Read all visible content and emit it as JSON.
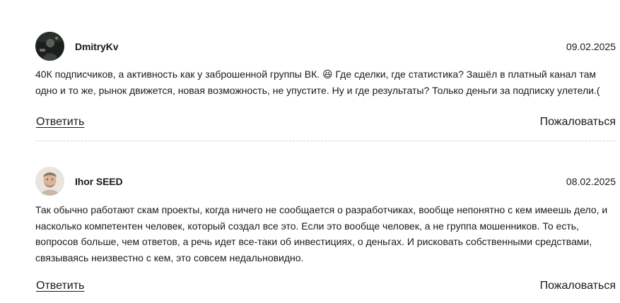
{
  "comments": [
    {
      "author": "DmitryKv",
      "date": "09.02.2025",
      "text": "40К подписчиков, а активность как у заброшенной группы ВК. 😆 Где сделки, где статистика? Зашёл в платный канал там\nодно и то же, рынок движется, новая возможность, не упустите. Ну и где результаты? Только деньги за подписку улетели.(",
      "reply_label": "Ответить",
      "report_label": "Пожаловаться"
    },
    {
      "author": "Ihor SEED",
      "date": "08.02.2025",
      "text": "Так обычно работают скам проекты, когда ничего не сообщается о разработчиках, вообще непонятно с кем имеешь дело, и\nнасколько компетентен человек, который создал все это. Если это вообще человек, а не группа мошенников. То есть,\nвопросов больше, чем ответов, а речь идет все-таки об инвестициях, о деньгах. И рисковать собственными средствами,\nсвязываясь неизвестно с кем, это совсем недальновидно.",
      "reply_label": "Ответить",
      "report_label": "Пожаловаться"
    }
  ]
}
